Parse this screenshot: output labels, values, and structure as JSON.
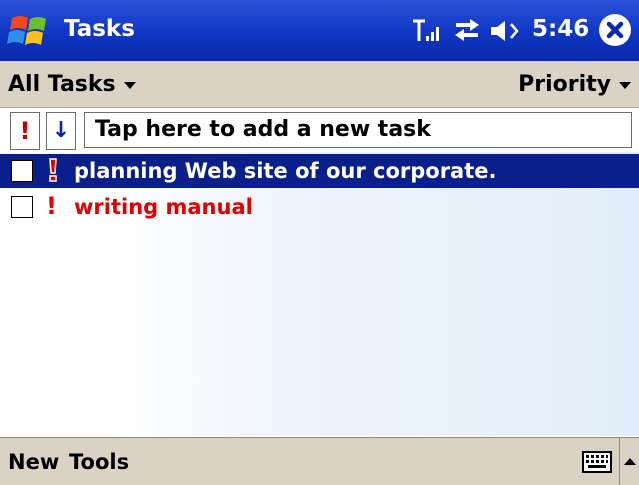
{
  "titlebar": {
    "app_title": "Tasks",
    "clock": "5:46",
    "icons": [
      "start-logo-icon",
      "signal-icon",
      "sync-icon",
      "volume-icon",
      "close-icon"
    ]
  },
  "filters": {
    "category": "All Tasks",
    "sort": "Priority"
  },
  "entry": {
    "priority_symbol": "!",
    "sort_symbol": "↓",
    "placeholder": "Tap here to add a new task"
  },
  "tasks": [
    {
      "title": "planning Web site of our corporate.",
      "priority_symbol": "!",
      "selected": true,
      "completed": false
    },
    {
      "title": "writing manual",
      "priority_symbol": "!",
      "selected": false,
      "completed": false
    }
  ],
  "menubar": {
    "new_label": "New",
    "tools_label": "Tools"
  },
  "colors": {
    "titlebar": "#0f36c4",
    "selection": "#0b1f8c",
    "high_priority_text": "#e00000",
    "bars": "#dad3c5"
  }
}
